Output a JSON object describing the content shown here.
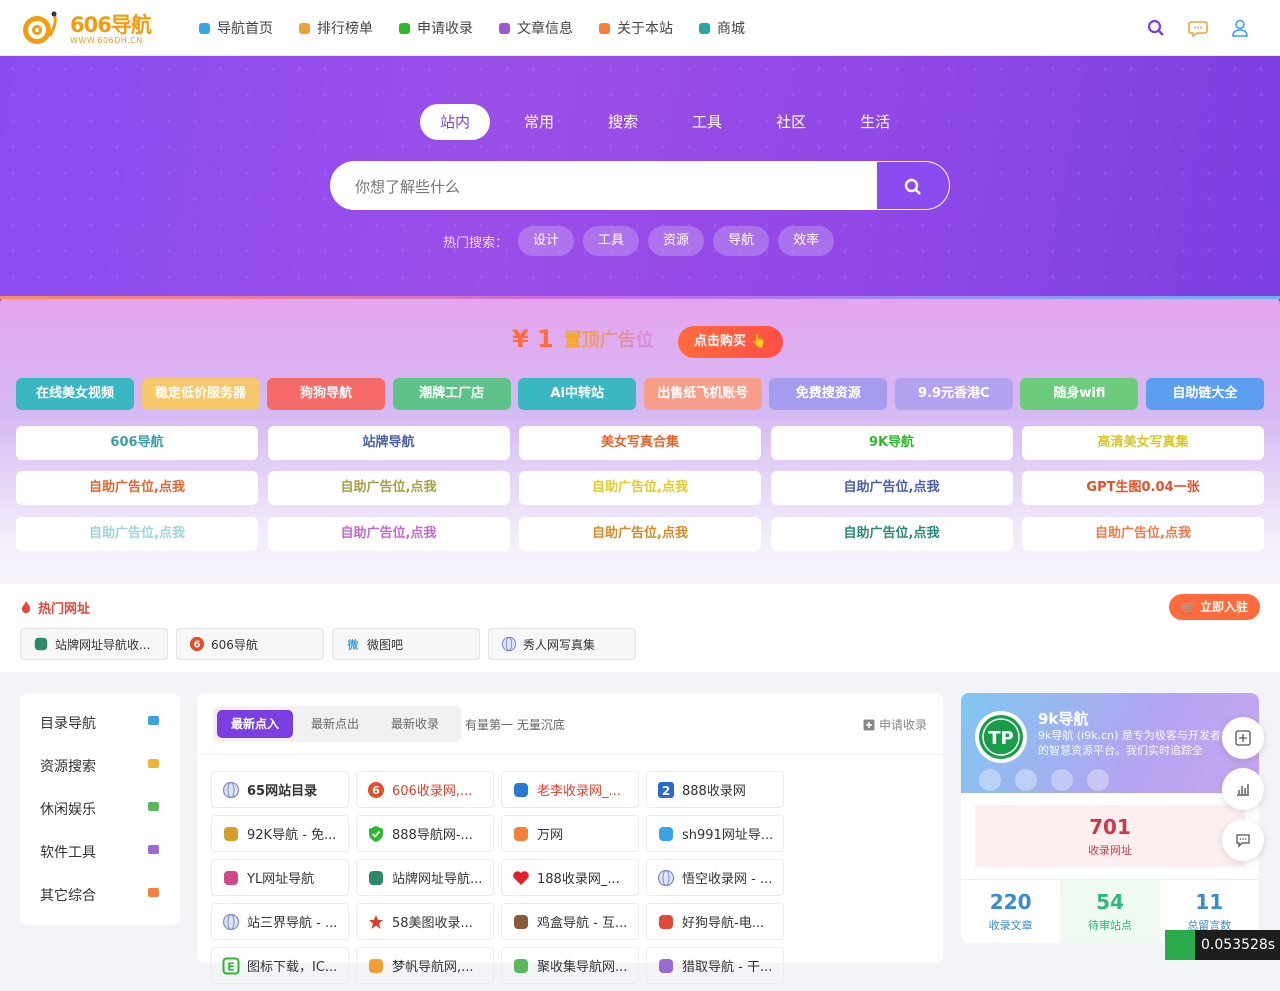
{
  "logo": {
    "text": "606导航",
    "sub": "WWW.606DH.CN"
  },
  "nav": [
    {
      "label": "导航首页",
      "icon": "home-icon",
      "color": "#3aa3e3"
    },
    {
      "label": "排行榜单",
      "icon": "flag-icon",
      "color": "#f0a03a"
    },
    {
      "label": "申请收录",
      "icon": "plus-square-icon",
      "color": "#2eb82e"
    },
    {
      "label": "文章信息",
      "icon": "book-icon",
      "color": "#9b59d0"
    },
    {
      "label": "关于本站",
      "icon": "info-icon",
      "color": "#f0803a"
    },
    {
      "label": "商城",
      "icon": "cart-icon",
      "color": "#2ba4a4"
    }
  ],
  "search": {
    "tabs": [
      "站内",
      "常用",
      "搜索",
      "工具",
      "社区",
      "生活"
    ],
    "active_tab": "站内",
    "placeholder": "你想了解些什么",
    "hot_label": "热门搜索：",
    "hot_keywords": [
      "设计",
      "工具",
      "资源",
      "导航",
      "效率"
    ]
  },
  "ad": {
    "price": "¥ 1",
    "price_label": "置顶广告位",
    "buy_label": "点击购买 👆",
    "row1": [
      {
        "label": "在线美女视频",
        "color": "#3bb7c4"
      },
      {
        "label": "稳定低价服务器",
        "color": "#f7c76b"
      },
      {
        "label": "狗狗导航",
        "color": "#f66a6a"
      },
      {
        "label": "潮牌工厂店",
        "color": "#5ec38a"
      },
      {
        "label": "Ai中转站",
        "color": "#3bb7c4"
      },
      {
        "label": "出售纸飞机账号",
        "color": "#f79e8a"
      },
      {
        "label": "免费搜资源",
        "color": "#a59cf0"
      },
      {
        "label": "9.9元香港C",
        "color": "#b2a2f0"
      },
      {
        "label": "随身wifi",
        "color": "#6ccb7c"
      },
      {
        "label": "自助链大全",
        "color": "#5c9ef0"
      }
    ],
    "row2": [
      {
        "label": "606导航",
        "color": "#3a9ea8"
      },
      {
        "label": "站牌导航",
        "color": "#4a5fa8"
      },
      {
        "label": "美女写真合集",
        "color": "#e0662f"
      },
      {
        "label": "9K导航",
        "color": "#2eb82e"
      },
      {
        "label": "高清美女写真集",
        "color": "#d6c82a"
      }
    ],
    "row3": [
      {
        "label": "自助广告位,点我",
        "color": "#e0662f"
      },
      {
        "label": "自助广告位,点我",
        "color": "#a8a048"
      },
      {
        "label": "自助广告位,点我",
        "color": "#e2cc2a"
      },
      {
        "label": "自助广告位,点我",
        "color": "#4a5fa8"
      },
      {
        "label": "GPT生图0.04一张",
        "color": "#e2502a"
      }
    ],
    "row4": [
      {
        "label": "自助广告位,点我",
        "color": "#9ed4e0"
      },
      {
        "label": "自助广告位,点我",
        "color": "#c46acc"
      },
      {
        "label": "自助广告位,点我",
        "color": "#d88a2a"
      },
      {
        "label": "自助广告位,点我",
        "color": "#2a8a7a"
      },
      {
        "label": "自助广告位,点我",
        "color": "#f07a4a"
      }
    ]
  },
  "hot_sites": {
    "title": "热门网址",
    "join_label": "立即入驻",
    "items": [
      {
        "label": "站牌网址导航收...",
        "icon": "cube-icon"
      },
      {
        "label": "606导航",
        "icon": "six-circle-icon"
      },
      {
        "label": "微图吧",
        "icon": "wei-icon"
      },
      {
        "label": "秀人网写真集",
        "icon": "globe-icon"
      }
    ]
  },
  "sidebar": [
    {
      "label": "目录导航",
      "icon": "paper-plane-icon",
      "color": "#3aa3e3"
    },
    {
      "label": "资源搜索",
      "icon": "file-icon",
      "color": "#f0b43a"
    },
    {
      "label": "休闲娱乐",
      "icon": "wrench-icon",
      "color": "#5cb85c"
    },
    {
      "label": "软件工具",
      "icon": "keyboard-icon",
      "color": "#9b6ad0"
    },
    {
      "label": "其它综合",
      "icon": "image-icon",
      "color": "#f0803a"
    }
  ],
  "main": {
    "tabs": [
      "最新点入",
      "最新点出",
      "最新收录"
    ],
    "active_tab": "最新点入",
    "slogan": "有量第一 无量沉底",
    "apply_label": "申请收录",
    "sites": [
      {
        "label": "65网站目录",
        "icon": "globe-icon",
        "color": "#333333",
        "bold": true
      },
      {
        "label": "606收录网,...",
        "icon": "six-circle-icon",
        "color": "#e0402a"
      },
      {
        "label": "老李收录网_...",
        "icon": "person-icon",
        "color": "#e0402a"
      },
      {
        "label": "888收录网",
        "icon": "two-icon",
        "color": "#333333"
      },
      {
        "label": "92K导航 - 免...",
        "icon": "stack-icon",
        "color": "#333333"
      },
      {
        "label": "888导航网-...",
        "icon": "shield-check-icon",
        "color": "#333333"
      },
      {
        "label": "万网",
        "icon": "bracket-icon",
        "color": "#333333"
      },
      {
        "label": "sh991网址导...",
        "icon": "gear-icon",
        "color": "#333333"
      },
      {
        "label": "YL网址导航",
        "icon": "pinwheel-icon",
        "color": "#333333"
      },
      {
        "label": "站牌网址导航...",
        "icon": "cube-icon",
        "color": "#333333"
      },
      {
        "label": "188收录网_...",
        "icon": "heart-icon",
        "color": "#333333"
      },
      {
        "label": "悟空收录网 - ...",
        "icon": "globe-icon",
        "color": "#333333"
      },
      {
        "label": "站三界导航 - ...",
        "icon": "globe-icon",
        "color": "#333333"
      },
      {
        "label": "58美图收录...",
        "icon": "star-icon",
        "color": "#333333"
      },
      {
        "label": "鸡盒导航 - 互...",
        "icon": "feather-icon",
        "color": "#333333"
      },
      {
        "label": "好狗导航-电...",
        "icon": "dog-icon",
        "color": "#333333"
      },
      {
        "label": "图标下载，IC...",
        "icon": "e-icon",
        "color": "#333333"
      },
      {
        "label": "梦帆导航网,...",
        "icon": "badge-icon",
        "color": "#333333"
      },
      {
        "label": "聚收集导航网...",
        "icon": "leaf-icon",
        "color": "#333333"
      },
      {
        "label": "猎取导航 - 干...",
        "icon": "grid-icon",
        "color": "#333333"
      }
    ]
  },
  "profile": {
    "name": "9k导航",
    "desc": "9k导航 (i9k.cn) 是专为极客与开发者打造的智慧资源平台。我们实时追踪全",
    "collected": {
      "value": "701",
      "label": "收录网址"
    },
    "stats": [
      {
        "value": "220",
        "label": "收录文章",
        "color": "#3a8ad0"
      },
      {
        "value": "54",
        "label": "待审站点",
        "color": "#2eb87a"
      },
      {
        "value": "11",
        "label": "总留言数",
        "color": "#3a8ad0"
      }
    ]
  },
  "timer": "0.053528s"
}
